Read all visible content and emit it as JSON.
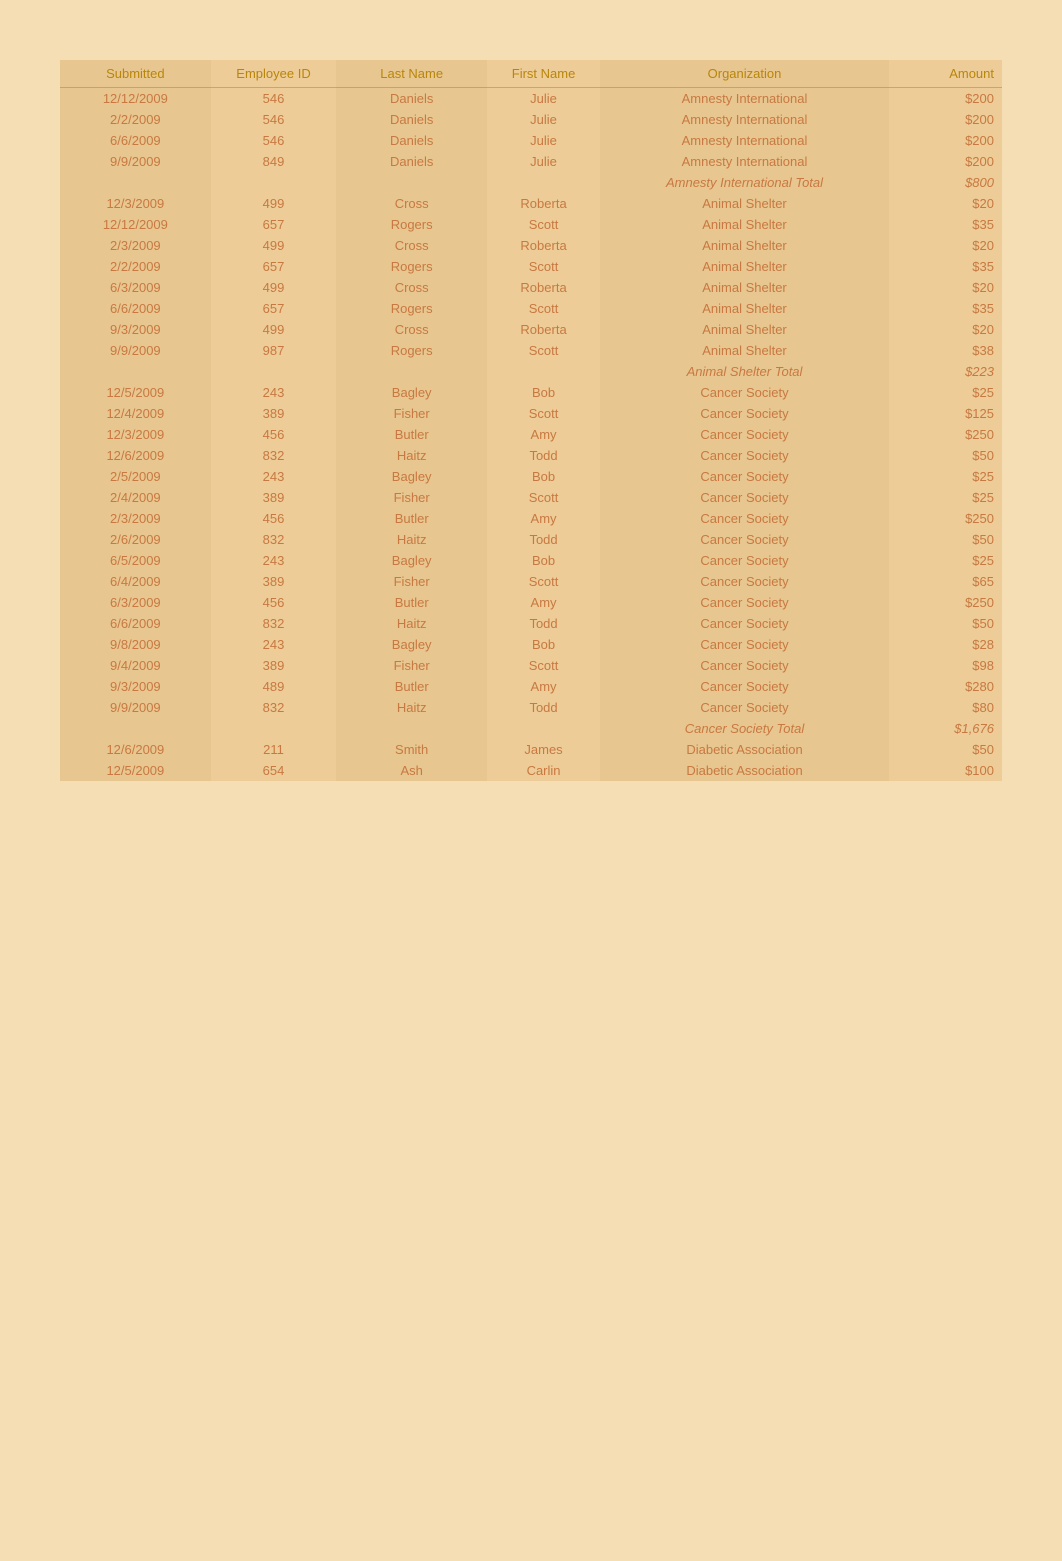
{
  "headers": {
    "submitted": "Submitted",
    "employee_id": "Employee ID",
    "last_name": "Last Name",
    "first_name": "First Name",
    "organization": "Organization",
    "amount": "Amount"
  },
  "rows": [
    {
      "submitted": "12/12/2009",
      "emp_id": "546",
      "last_name": "Daniels",
      "first_name": "Julie",
      "org": "Amnesty International",
      "amount": "$200",
      "type": "data"
    },
    {
      "submitted": "2/2/2009",
      "emp_id": "546",
      "last_name": "Daniels",
      "first_name": "Julie",
      "org": "Amnesty International",
      "amount": "$200",
      "type": "data"
    },
    {
      "submitted": "6/6/2009",
      "emp_id": "546",
      "last_name": "Daniels",
      "first_name": "Julie",
      "org": "Amnesty International",
      "amount": "$200",
      "type": "data"
    },
    {
      "submitted": "9/9/2009",
      "emp_id": "849",
      "last_name": "Daniels",
      "first_name": "Julie",
      "org": "Amnesty International",
      "amount": "$200",
      "type": "data"
    },
    {
      "submitted": "",
      "emp_id": "",
      "last_name": "",
      "first_name": "",
      "org": "Amnesty International Total",
      "amount": "$800",
      "type": "subtotal"
    },
    {
      "submitted": "12/3/2009",
      "emp_id": "499",
      "last_name": "Cross",
      "first_name": "Roberta",
      "org": "Animal Shelter",
      "amount": "$20",
      "type": "data"
    },
    {
      "submitted": "12/12/2009",
      "emp_id": "657",
      "last_name": "Rogers",
      "first_name": "Scott",
      "org": "Animal Shelter",
      "amount": "$35",
      "type": "data"
    },
    {
      "submitted": "2/3/2009",
      "emp_id": "499",
      "last_name": "Cross",
      "first_name": "Roberta",
      "org": "Animal Shelter",
      "amount": "$20",
      "type": "data"
    },
    {
      "submitted": "2/2/2009",
      "emp_id": "657",
      "last_name": "Rogers",
      "first_name": "Scott",
      "org": "Animal Shelter",
      "amount": "$35",
      "type": "data"
    },
    {
      "submitted": "6/3/2009",
      "emp_id": "499",
      "last_name": "Cross",
      "first_name": "Roberta",
      "org": "Animal Shelter",
      "amount": "$20",
      "type": "data"
    },
    {
      "submitted": "6/6/2009",
      "emp_id": "657",
      "last_name": "Rogers",
      "first_name": "Scott",
      "org": "Animal Shelter",
      "amount": "$35",
      "type": "data"
    },
    {
      "submitted": "9/3/2009",
      "emp_id": "499",
      "last_name": "Cross",
      "first_name": "Roberta",
      "org": "Animal Shelter",
      "amount": "$20",
      "type": "data"
    },
    {
      "submitted": "9/9/2009",
      "emp_id": "987",
      "last_name": "Rogers",
      "first_name": "Scott",
      "org": "Animal Shelter",
      "amount": "$38",
      "type": "data"
    },
    {
      "submitted": "",
      "emp_id": "",
      "last_name": "",
      "first_name": "",
      "org": "Animal Shelter Total",
      "amount": "$223",
      "type": "subtotal"
    },
    {
      "submitted": "12/5/2009",
      "emp_id": "243",
      "last_name": "Bagley",
      "first_name": "Bob",
      "org": "Cancer Society",
      "amount": "$25",
      "type": "data"
    },
    {
      "submitted": "12/4/2009",
      "emp_id": "389",
      "last_name": "Fisher",
      "first_name": "Scott",
      "org": "Cancer Society",
      "amount": "$125",
      "type": "data"
    },
    {
      "submitted": "12/3/2009",
      "emp_id": "456",
      "last_name": "Butler",
      "first_name": "Amy",
      "org": "Cancer Society",
      "amount": "$250",
      "type": "data"
    },
    {
      "submitted": "12/6/2009",
      "emp_id": "832",
      "last_name": "Haitz",
      "first_name": "Todd",
      "org": "Cancer Society",
      "amount": "$50",
      "type": "data"
    },
    {
      "submitted": "2/5/2009",
      "emp_id": "243",
      "last_name": "Bagley",
      "first_name": "Bob",
      "org": "Cancer Society",
      "amount": "$25",
      "type": "data"
    },
    {
      "submitted": "2/4/2009",
      "emp_id": "389",
      "last_name": "Fisher",
      "first_name": "Scott",
      "org": "Cancer Society",
      "amount": "$25",
      "type": "data"
    },
    {
      "submitted": "2/3/2009",
      "emp_id": "456",
      "last_name": "Butler",
      "first_name": "Amy",
      "org": "Cancer Society",
      "amount": "$250",
      "type": "data"
    },
    {
      "submitted": "2/6/2009",
      "emp_id": "832",
      "last_name": "Haitz",
      "first_name": "Todd",
      "org": "Cancer Society",
      "amount": "$50",
      "type": "data"
    },
    {
      "submitted": "6/5/2009",
      "emp_id": "243",
      "last_name": "Bagley",
      "first_name": "Bob",
      "org": "Cancer Society",
      "amount": "$25",
      "type": "data"
    },
    {
      "submitted": "6/4/2009",
      "emp_id": "389",
      "last_name": "Fisher",
      "first_name": "Scott",
      "org": "Cancer Society",
      "amount": "$65",
      "type": "data"
    },
    {
      "submitted": "6/3/2009",
      "emp_id": "456",
      "last_name": "Butler",
      "first_name": "Amy",
      "org": "Cancer Society",
      "amount": "$250",
      "type": "data"
    },
    {
      "submitted": "6/6/2009",
      "emp_id": "832",
      "last_name": "Haitz",
      "first_name": "Todd",
      "org": "Cancer Society",
      "amount": "$50",
      "type": "data"
    },
    {
      "submitted": "9/8/2009",
      "emp_id": "243",
      "last_name": "Bagley",
      "first_name": "Bob",
      "org": "Cancer Society",
      "amount": "$28",
      "type": "data"
    },
    {
      "submitted": "9/4/2009",
      "emp_id": "389",
      "last_name": "Fisher",
      "first_name": "Scott",
      "org": "Cancer Society",
      "amount": "$98",
      "type": "data"
    },
    {
      "submitted": "9/3/2009",
      "emp_id": "489",
      "last_name": "Butler",
      "first_name": "Amy",
      "org": "Cancer Society",
      "amount": "$280",
      "type": "data"
    },
    {
      "submitted": "9/9/2009",
      "emp_id": "832",
      "last_name": "Haitz",
      "first_name": "Todd",
      "org": "Cancer Society",
      "amount": "$80",
      "type": "data"
    },
    {
      "submitted": "",
      "emp_id": "",
      "last_name": "",
      "first_name": "",
      "org": "Cancer Society Total",
      "amount": "$1,676",
      "type": "subtotal"
    },
    {
      "submitted": "12/6/2009",
      "emp_id": "211",
      "last_name": "Smith",
      "first_name": "James",
      "org": "Diabetic Association",
      "amount": "$50",
      "type": "data"
    },
    {
      "submitted": "12/5/2009",
      "emp_id": "654",
      "last_name": "Ash",
      "first_name": "Carlin",
      "org": "Diabetic Association",
      "amount": "$100",
      "type": "data"
    }
  ]
}
